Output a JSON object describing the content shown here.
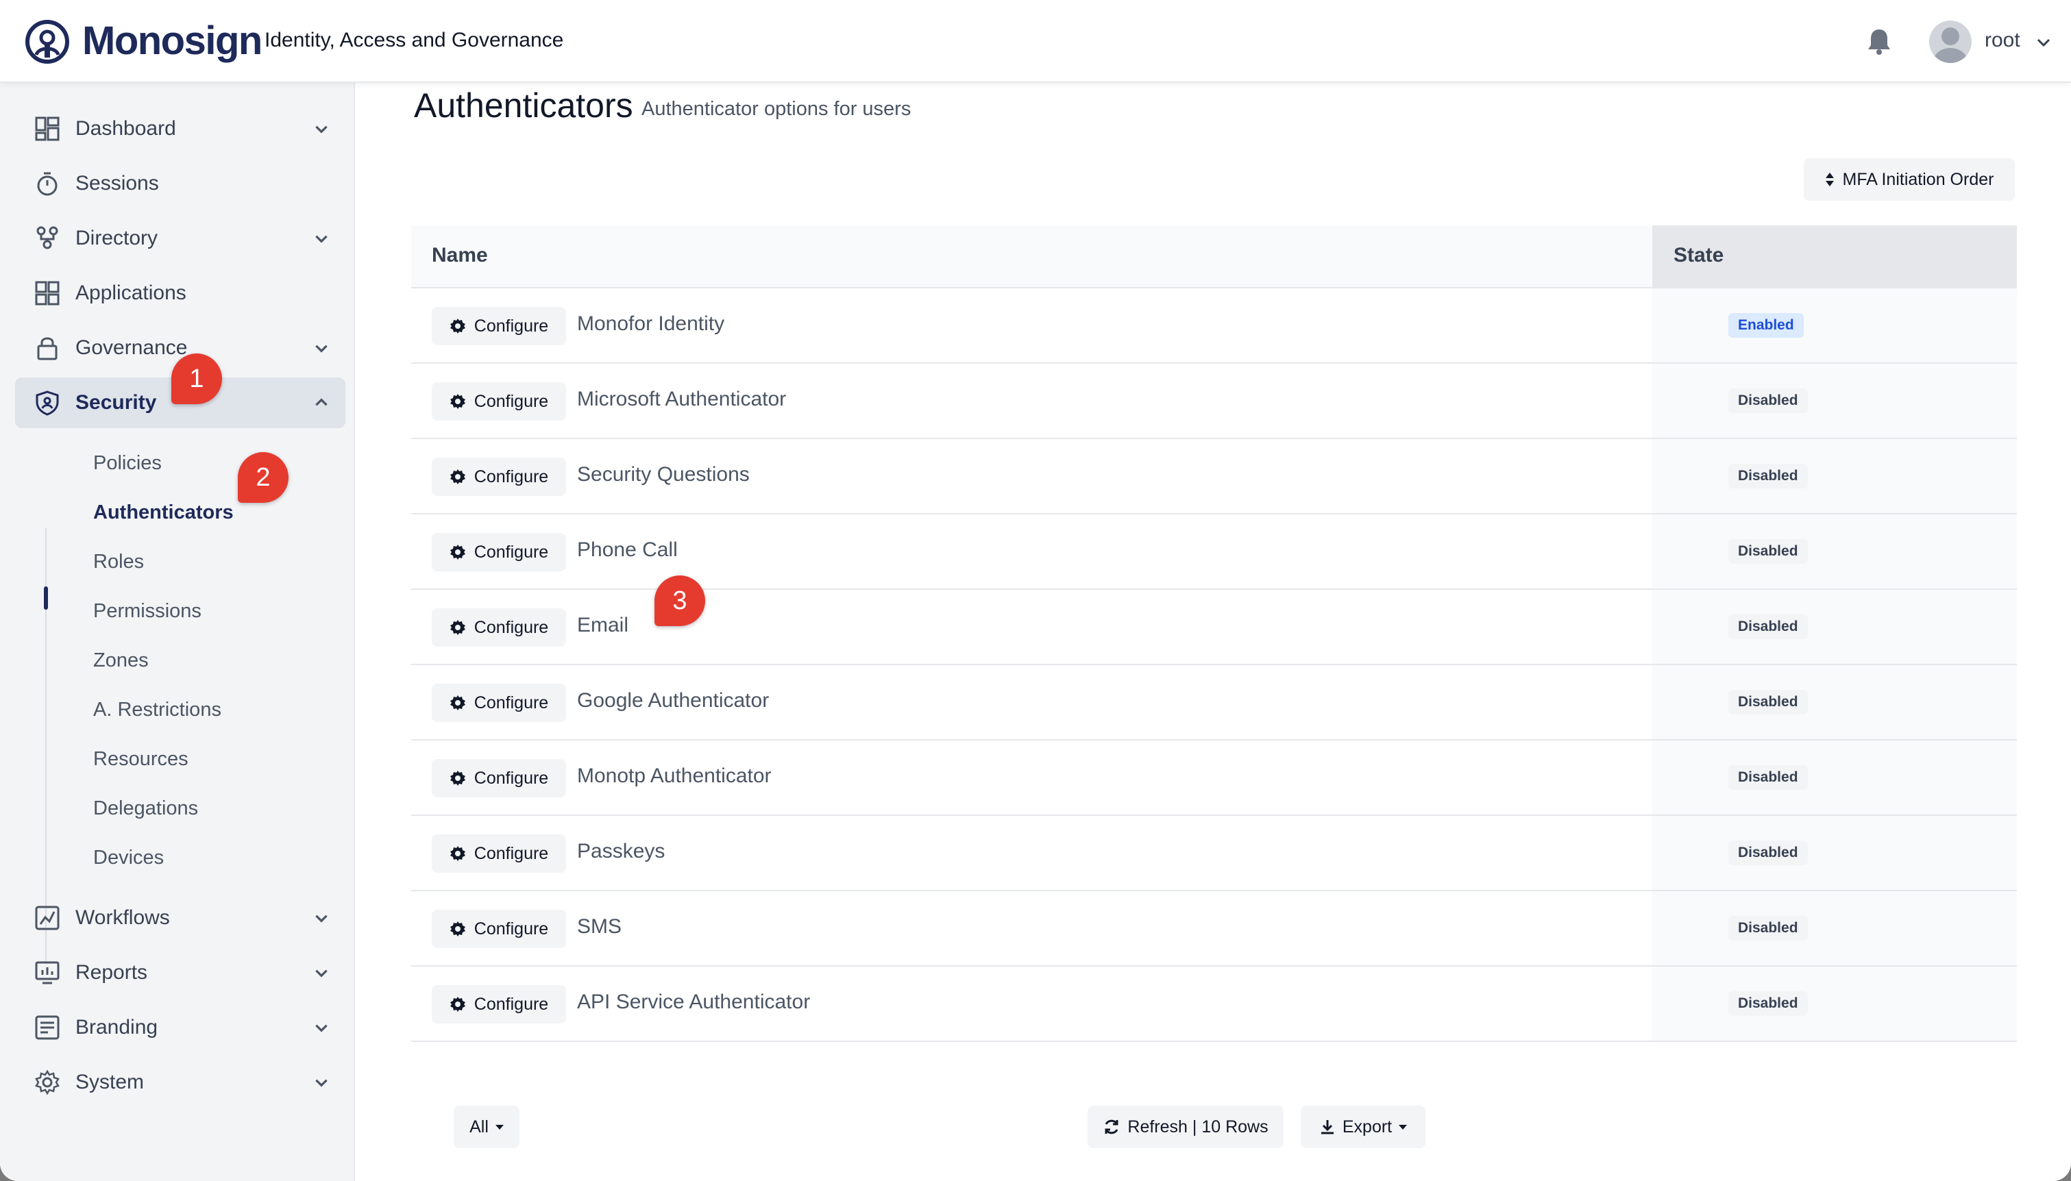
{
  "header": {
    "brand": "Monosign",
    "tagline": "Identity, Access and Governance",
    "user": "root"
  },
  "sidebar": {
    "items": [
      {
        "label": "Dashboard",
        "icon": "dashboard-icon"
      },
      {
        "label": "Sessions",
        "icon": "stopwatch-icon"
      },
      {
        "label": "Directory",
        "icon": "directory-icon"
      },
      {
        "label": "Applications",
        "icon": "applications-icon"
      },
      {
        "label": "Governance",
        "icon": "lock-icon"
      },
      {
        "label": "Security",
        "icon": "shield-icon"
      },
      {
        "label": "Workflows",
        "icon": "workflow-icon"
      },
      {
        "label": "Reports",
        "icon": "reports-icon"
      },
      {
        "label": "Branding",
        "icon": "branding-icon"
      },
      {
        "label": "System",
        "icon": "gear-icon"
      }
    ],
    "security_sub": [
      "Policies",
      "Authenticators",
      "Roles",
      "Permissions",
      "Zones",
      "A. Restrictions",
      "Resources",
      "Delegations",
      "Devices"
    ]
  },
  "main": {
    "title": "Authenticators",
    "subtitle": "Authenticator options for users",
    "mfa_button": "MFA Initiation Order",
    "table": {
      "col_name": "Name",
      "col_state": "State",
      "configure_label": "Configure",
      "rows": [
        {
          "name": "Monofor Identity",
          "state": "Enabled"
        },
        {
          "name": "Microsoft Authenticator",
          "state": "Disabled"
        },
        {
          "name": "Security Questions",
          "state": "Disabled"
        },
        {
          "name": "Phone Call",
          "state": "Disabled"
        },
        {
          "name": "Email",
          "state": "Disabled"
        },
        {
          "name": "Google Authenticator",
          "state": "Disabled"
        },
        {
          "name": "Monotp Authenticator",
          "state": "Disabled"
        },
        {
          "name": "Passkeys",
          "state": "Disabled"
        },
        {
          "name": "SMS",
          "state": "Disabled"
        },
        {
          "name": "API Service Authenticator",
          "state": "Disabled"
        }
      ]
    },
    "footer": {
      "filter": "All",
      "refresh": "Refresh | 10 Rows",
      "export": "Export"
    }
  },
  "annotations": [
    "1",
    "2",
    "3"
  ],
  "colors": {
    "brand": "#1e2a5a",
    "accent_badge": "#1d4ed8",
    "annotation": "#e53b2f"
  }
}
